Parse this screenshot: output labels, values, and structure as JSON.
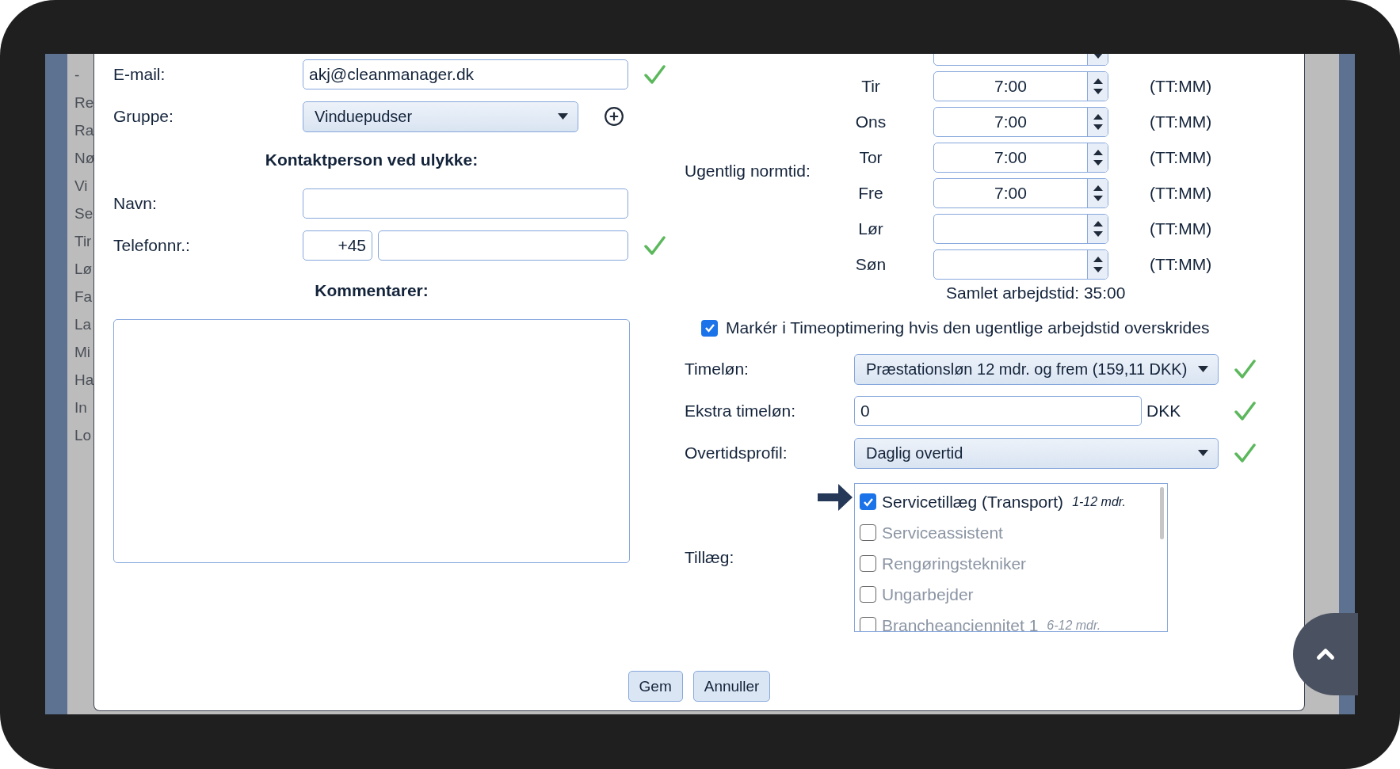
{
  "background_menu": [
    "-",
    "Re",
    "Ra",
    "Nø",
    "Vi",
    "Se",
    "Tir",
    "Lø",
    "Fa",
    "La",
    "Mi",
    "Ha",
    "In",
    "Lo"
  ],
  "email": {
    "label": "E-mail:",
    "value": "akj@cleanmanager.dk",
    "valid": true
  },
  "group": {
    "label": "Gruppe:",
    "value": "Vinduepudser"
  },
  "emergency_contact": {
    "heading": "Kontaktperson ved ulykke:",
    "name_label": "Navn:",
    "phone_label": "Telefonnr.:",
    "phone_prefix": "+45",
    "valid": true
  },
  "comments": {
    "heading": "Kommentarer:"
  },
  "weekly_hours": {
    "label": "Ugentlig normtid:",
    "days": [
      {
        "day": "Tir",
        "value": "7:00",
        "unit": "(TT:MM)"
      },
      {
        "day": "Ons",
        "value": "7:00",
        "unit": "(TT:MM)"
      },
      {
        "day": "Tor",
        "value": "7:00",
        "unit": "(TT:MM)"
      },
      {
        "day": "Fre",
        "value": "7:00",
        "unit": "(TT:MM)"
      },
      {
        "day": "Lør",
        "unit": "(TT:MM)"
      },
      {
        "day": "Søn",
        "unit": "(TT:MM)"
      }
    ],
    "total": "Samlet arbejdstid: 35:00"
  },
  "mark_overtime": {
    "label": "Markér i Timeoptimering hvis den ugentlige arbejdstid overskrides",
    "checked": true
  },
  "hourly_wage": {
    "label": "Timeløn:",
    "value": "Præstationsløn 12 mdr. og frem (159,11 DKK)",
    "valid": true
  },
  "extra_wage": {
    "label": "Ekstra timeløn:",
    "value": "0",
    "unit": "DKK",
    "valid": true
  },
  "overtime_profile": {
    "label": "Overtidsprofil:",
    "value": "Daglig overtid",
    "valid": true
  },
  "supplements": {
    "label": "Tillæg:",
    "items": [
      {
        "label": "Servicetillæg (Transport)",
        "note": "1-12 mdr.",
        "checked": true
      },
      {
        "label": "Serviceassistent",
        "checked": false
      },
      {
        "label": "Rengøringstekniker",
        "checked": false
      },
      {
        "label": "Ungarbejder",
        "checked": false
      },
      {
        "label": "Brancheanciennitet 1",
        "note": "6-12 mdr.",
        "checked": false
      }
    ]
  },
  "buttons": [
    "Gem",
    "Annuller"
  ]
}
